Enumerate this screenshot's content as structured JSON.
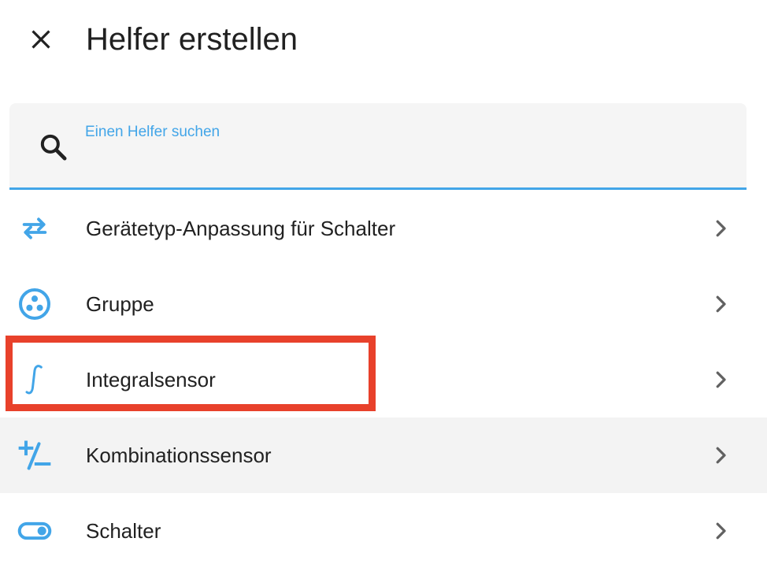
{
  "header": {
    "title": "Helfer erstellen",
    "close_icon": "close-icon"
  },
  "search": {
    "label": "Einen Helfer suchen",
    "value": "",
    "icon": "search-icon"
  },
  "helpers": [
    {
      "label": "Gerätetyp-Anpassung für Schalter",
      "icon": "swap-arrows-icon"
    },
    {
      "label": "Gruppe",
      "icon": "group-circle-icon"
    },
    {
      "label": "Integralsensor",
      "icon": "integral-icon",
      "highlighted": true
    },
    {
      "label": "Kombinationssensor",
      "icon": "plus-minus-icon",
      "hovered": true
    },
    {
      "label": "Schalter",
      "icon": "toggle-switch-icon"
    }
  ],
  "colors": {
    "accent": "#42a5e8",
    "highlight_box": "#e8412b",
    "hover_row": "#f3f3f3"
  }
}
